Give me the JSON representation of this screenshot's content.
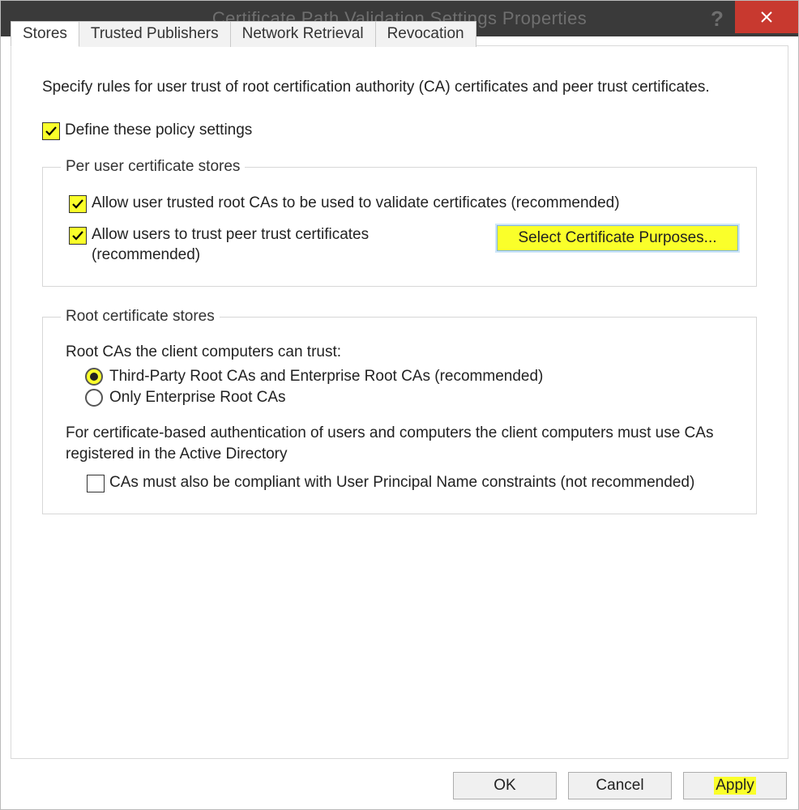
{
  "window": {
    "title": "Certificate Path Validation Settings Properties"
  },
  "tabs": {
    "stores": "Stores",
    "trusted_publishers": "Trusted Publishers",
    "network_retrieval": "Network Retrieval",
    "revocation": "Revocation"
  },
  "intro": "Specify rules for user trust of root certification authority (CA) certificates and peer trust certificates.",
  "define_policy": "Define these policy settings",
  "group_peruser": {
    "legend": "Per user certificate stores",
    "allow_root": "Allow user trusted root CAs to be used to validate certificates (recommended)",
    "allow_peer": "Allow users to trust peer trust certificates (recommended)",
    "select_purposes": "Select Certificate Purposes..."
  },
  "group_root": {
    "legend": "Root certificate stores",
    "prompt": "Root CAs the client computers can trust:",
    "opt_third": "Third-Party Root CAs and Enterprise Root CAs (recommended)",
    "opt_enterprise": "Only Enterprise Root CAs",
    "footnote": "For certificate-based authentication of users and computers the client computers must use CAs registered in the Active Directory",
    "upn": "CAs must also be compliant with User Principal Name constraints (not recommended)"
  },
  "buttons": {
    "ok": "OK",
    "cancel": "Cancel",
    "apply": "Apply"
  }
}
